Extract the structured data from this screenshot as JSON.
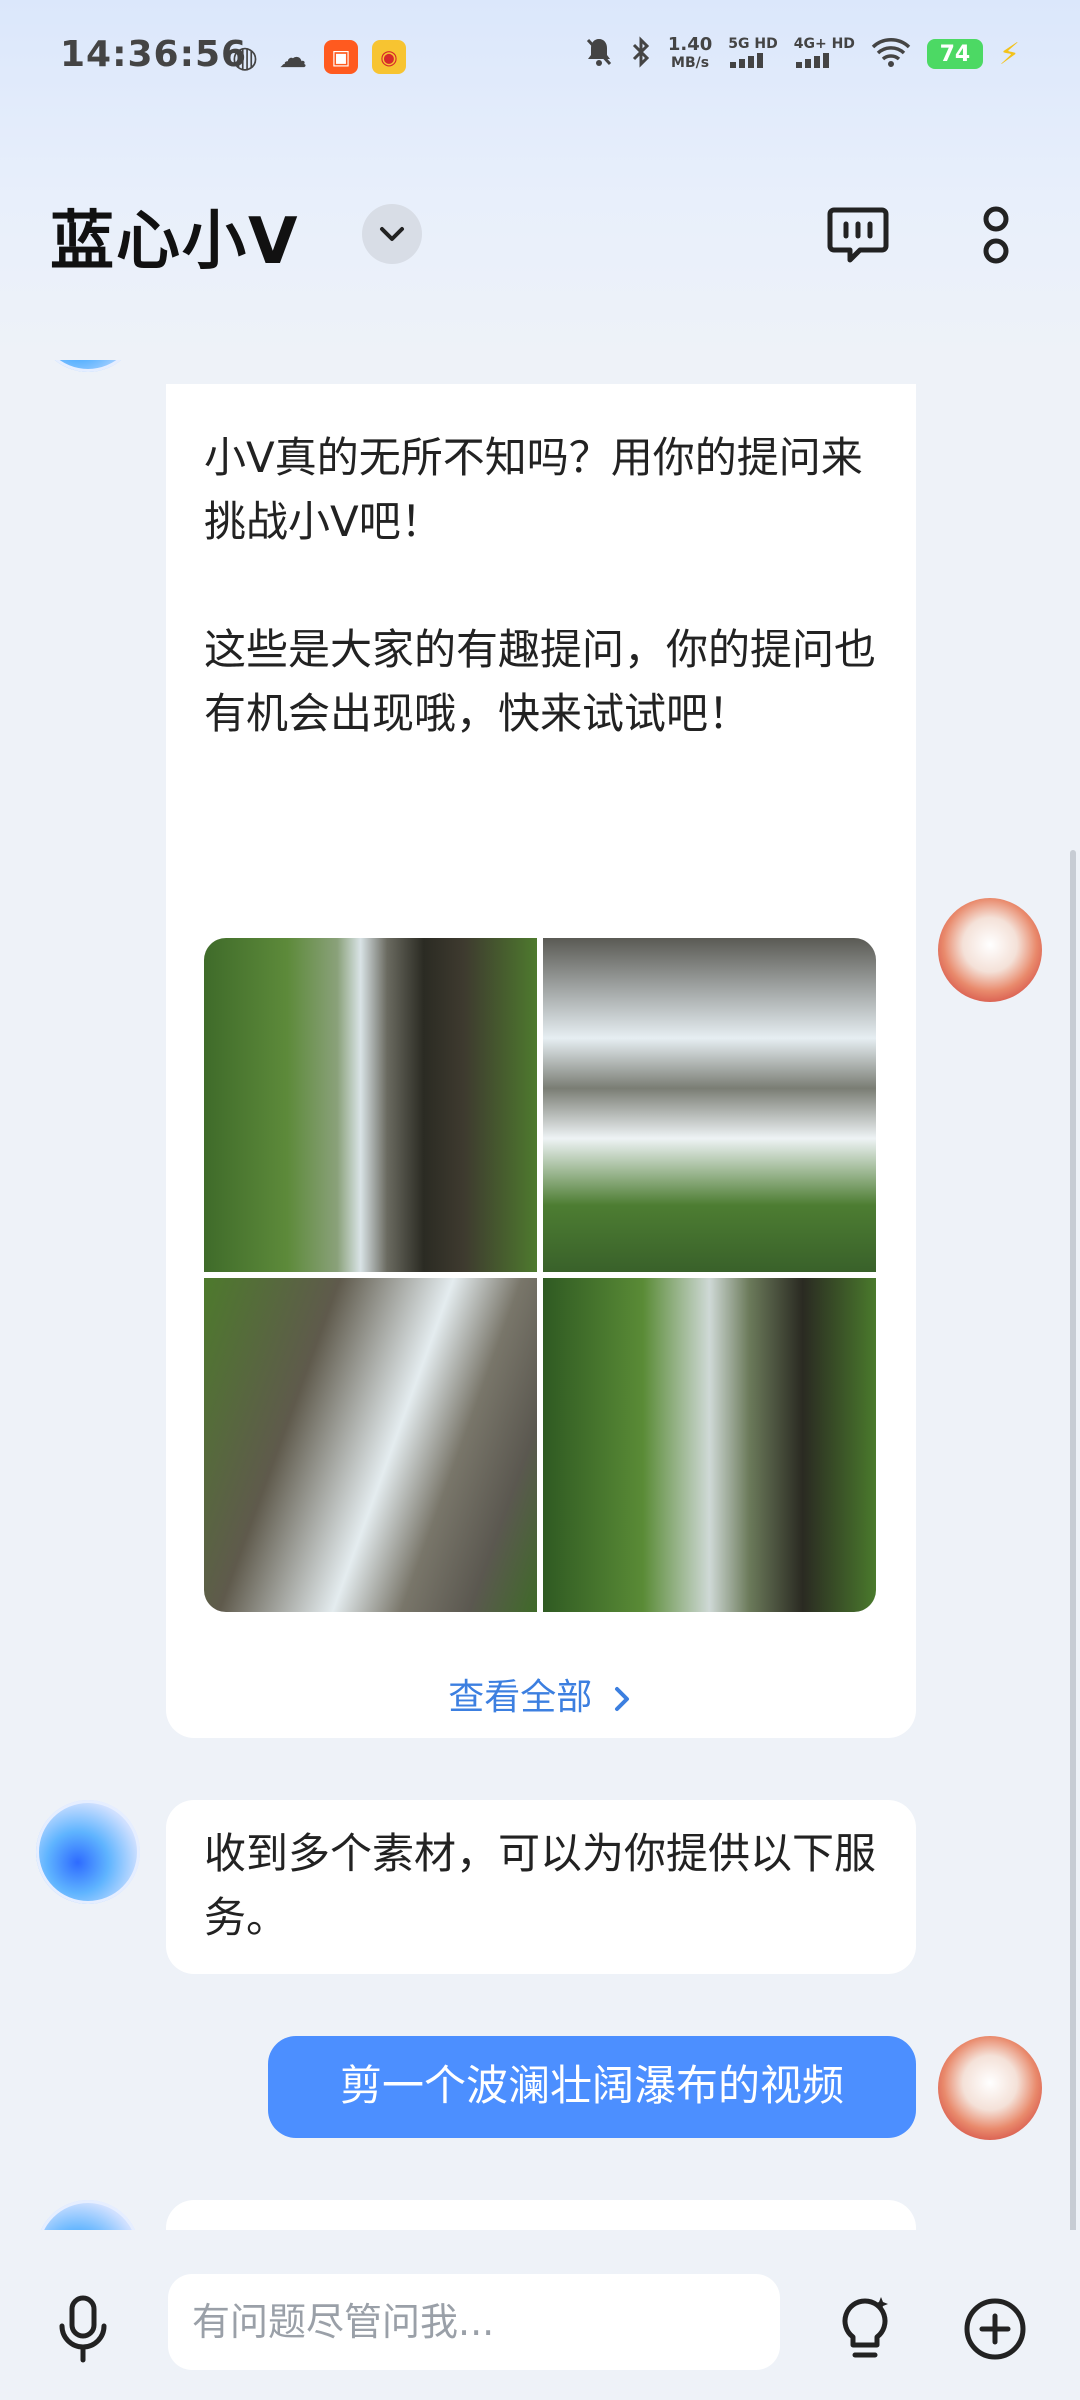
{
  "status_bar": {
    "time": "14:36:56",
    "net_speed_value": "1.40",
    "net_speed_unit": "MB/s",
    "sim1": "5G HD",
    "sim2": "4G+ HD",
    "battery": "74"
  },
  "header": {
    "title": "蓝心小V"
  },
  "messages": {
    "intro_paragraph_1": "小V真的无所不知吗？用你的提问来挑战小V吧！",
    "intro_paragraph_2": "这些是大家的有趣提问，你的提问也有机会出现哦，快来试试吧！",
    "see_all_label": "查看全部",
    "bot_reply": "收到多个素材，可以为你提供以下服务。",
    "user_message": "剪一个波澜壮阔瀑布的视频"
  },
  "input": {
    "placeholder": "有问题尽管问我..."
  },
  "colors": {
    "accent": "#4c8fff",
    "link": "#3c7fe0",
    "background": "#eef2f8"
  }
}
